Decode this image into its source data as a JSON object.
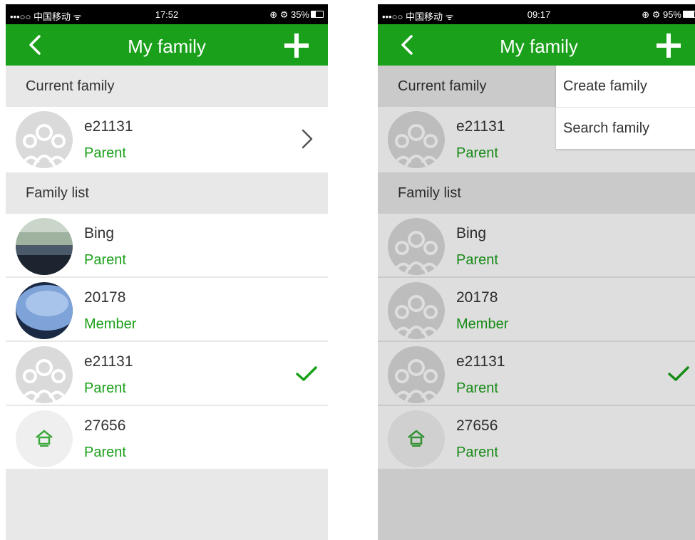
{
  "screens": [
    {
      "status": {
        "left": "•••○○ 中国移动 ᯤ",
        "time": "17:52",
        "right": "⊕ ⚙ 35%",
        "battery_level": 0.35
      },
      "title": "My family",
      "current_header": "Current family",
      "current": {
        "name": "e21131",
        "role": "Parent",
        "avatar": "group-placeholder"
      },
      "list_header": "Family list",
      "families": [
        {
          "name": "Bing",
          "role": "Parent",
          "avatar": "photo-landscape",
          "selected": false
        },
        {
          "name": "20178",
          "role": "Member",
          "avatar": "photo-blue",
          "selected": false
        },
        {
          "name": "e21131",
          "role": "Parent",
          "avatar": "group-placeholder",
          "selected": true
        },
        {
          "name": "27656",
          "role": "Parent",
          "avatar": "house-logo",
          "selected": false
        }
      ]
    },
    {
      "status": {
        "left": "•••○○ 中国移动 ᯤ",
        "time": "09:17",
        "right": "⊕ ⚙ 95%",
        "battery_level": 0.95
      },
      "title": "My family",
      "current_header": "Current family",
      "current": {
        "name": "e21131",
        "role": "Parent",
        "avatar": "group-placeholder"
      },
      "list_header": "Family list",
      "families": [
        {
          "name": "Bing",
          "role": "Parent",
          "avatar": "group-placeholder",
          "selected": false
        },
        {
          "name": "20178",
          "role": "Member",
          "avatar": "group-placeholder",
          "selected": false
        },
        {
          "name": "e21131",
          "role": "Parent",
          "avatar": "group-placeholder",
          "selected": true
        },
        {
          "name": "27656",
          "role": "Parent",
          "avatar": "house-logo",
          "selected": false
        }
      ],
      "menu": [
        "Create family",
        "Search family"
      ]
    }
  ],
  "colors": {
    "accent": "#1aa01a",
    "background": "#e8e8e8",
    "text": "#333333"
  },
  "icons": {
    "back": "chevron-left-icon",
    "add": "plus-icon",
    "forward": "chevron-right-icon",
    "selected": "checkmark-icon"
  }
}
